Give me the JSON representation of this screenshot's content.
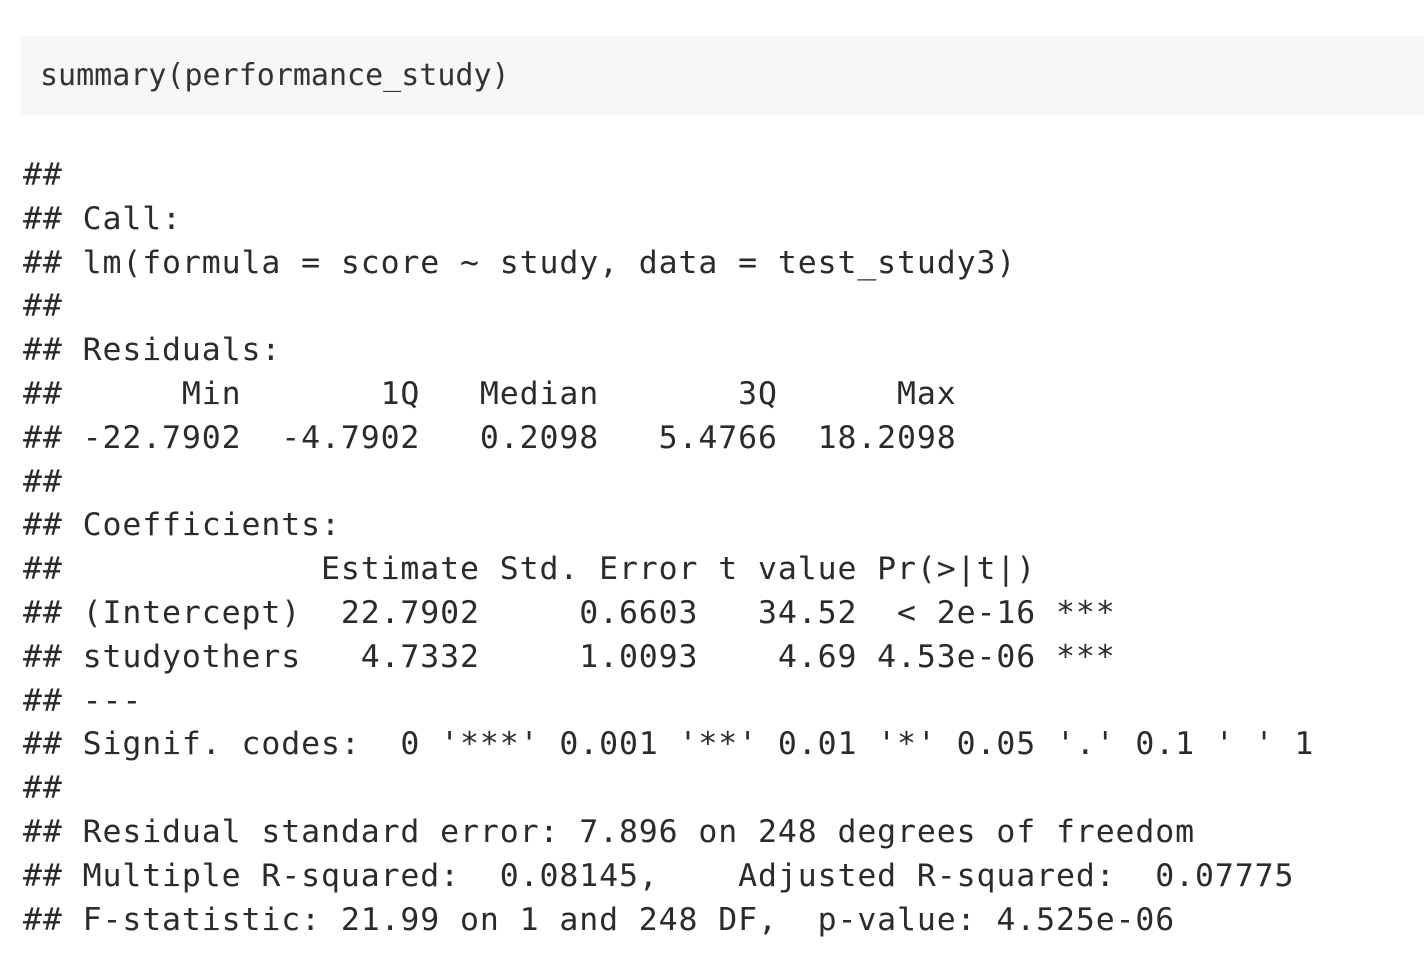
{
  "code": {
    "input": "summary(performance_study)"
  },
  "output": {
    "lines": [
      "##",
      "## Call:",
      "## lm(formula = score ~ study, data = test_study3)",
      "##",
      "## Residuals:",
      "##      Min       1Q   Median       3Q      Max ",
      "## -22.7902  -4.7902   0.2098   5.4766  18.2098 ",
      "##",
      "## Coefficients:",
      "##             Estimate Std. Error t value Pr(>|t|)    ",
      "## (Intercept)  22.7902     0.6603   34.52  < 2e-16 ***",
      "## studyothers   4.7332     1.0093    4.69 4.53e-06 ***",
      "## ---",
      "## Signif. codes:  0 '***' 0.001 '**' 0.01 '*' 0.05 '.' 0.1 ' ' 1",
      "##",
      "## Residual standard error: 7.896 on 248 degrees of freedom",
      "## Multiple R-squared:  0.08145,    Adjusted R-squared:  0.07775 ",
      "## F-statistic: 21.99 on 1 and 248 DF,  p-value: 4.525e-06"
    ]
  }
}
